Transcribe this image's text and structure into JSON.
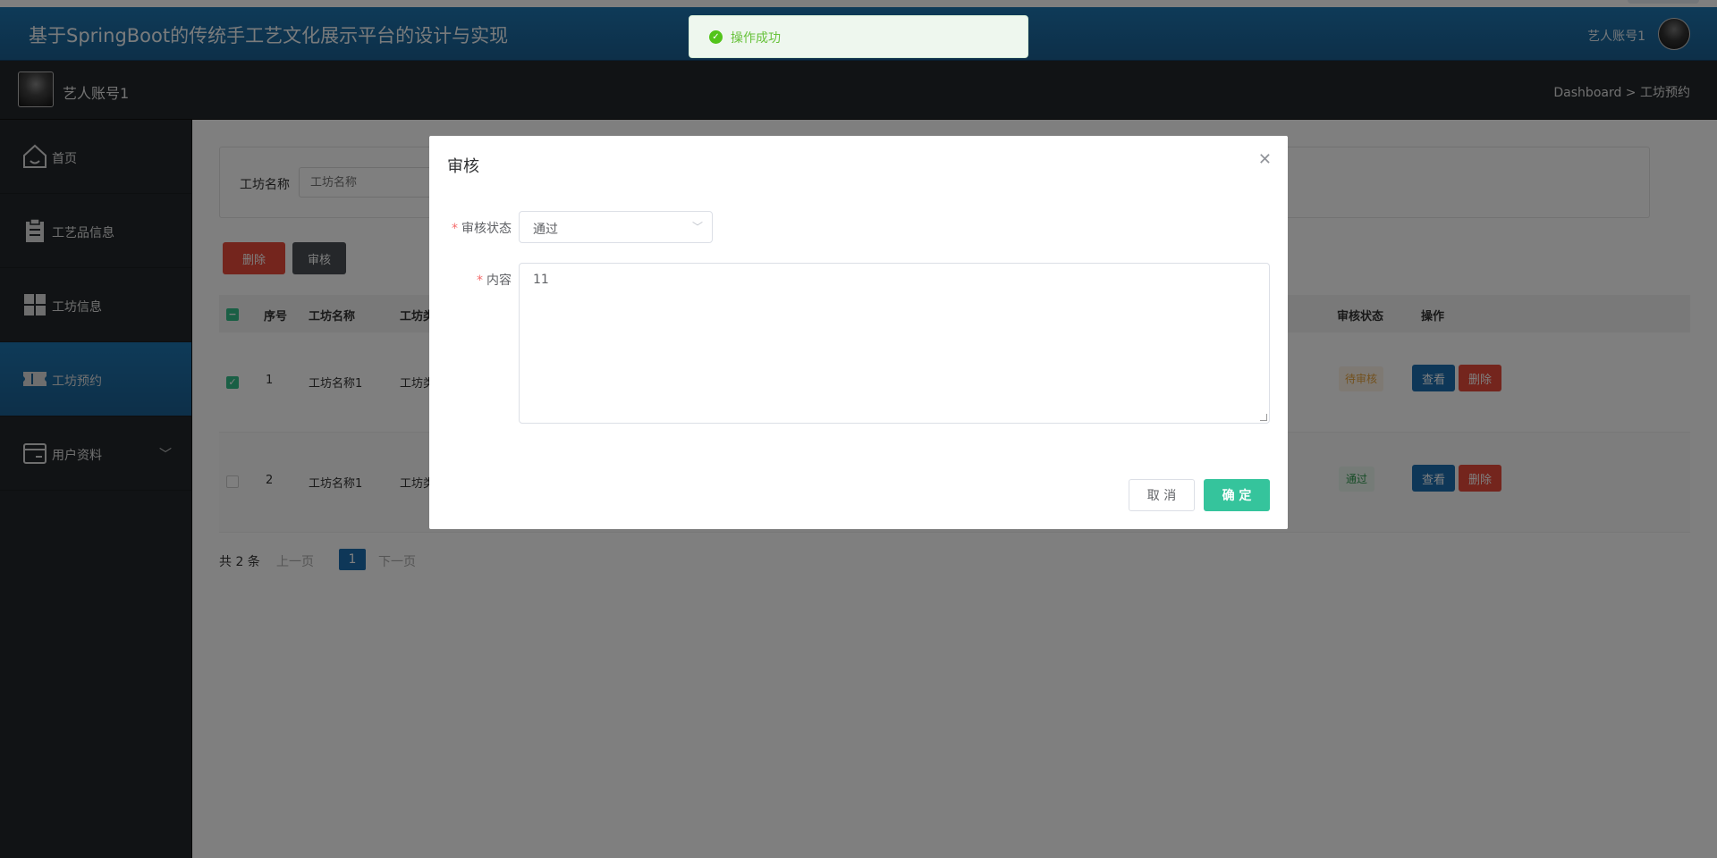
{
  "header": {
    "title": "基于SpringBoot的传统手工艺文化展示平台的设计与实现",
    "user": "艺人账号1"
  },
  "subheader": {
    "name": "艺人账号1",
    "breadcrumb": "Dashboard > 工坊预约"
  },
  "sidebar": {
    "items": [
      {
        "label": "首页",
        "icon": "home-icon"
      },
      {
        "label": "工艺品信息",
        "icon": "clipboard-icon"
      },
      {
        "label": "工坊信息",
        "icon": "grid-icon"
      },
      {
        "label": "工坊预约",
        "icon": "ticket-icon"
      },
      {
        "label": "用户资料",
        "icon": "card-icon"
      }
    ],
    "active_index": 3
  },
  "search": {
    "label": "工坊名称",
    "placeholder": "工坊名称"
  },
  "toolbar": {
    "delete_label": "删除",
    "audit_label": "审核"
  },
  "table": {
    "columns": [
      "序号",
      "工坊名称",
      "工坊类",
      "审核状态",
      "操作"
    ],
    "rows": [
      {
        "index": "1",
        "name": "工坊名称1",
        "type": "工坊类",
        "status": "待审核",
        "checked": true
      },
      {
        "index": "2",
        "name": "工坊名称1",
        "type": "工坊类",
        "status": "通过",
        "checked": false
      }
    ],
    "view_label": "查看",
    "delete_label": "删除"
  },
  "pager": {
    "total": "共 2 条",
    "prev": "上一页",
    "current": "1",
    "next": "下一页"
  },
  "toast": {
    "message": "操作成功"
  },
  "dialog": {
    "title": "审核",
    "status_label": "审核状态",
    "status_value": "通过",
    "content_label": "内容",
    "content_value": "11",
    "cancel_label": "取 消",
    "ok_label": "确 定"
  },
  "colors": {
    "primary": "#1d6fb0",
    "danger": "#e84a3a",
    "success": "#35c49c"
  }
}
